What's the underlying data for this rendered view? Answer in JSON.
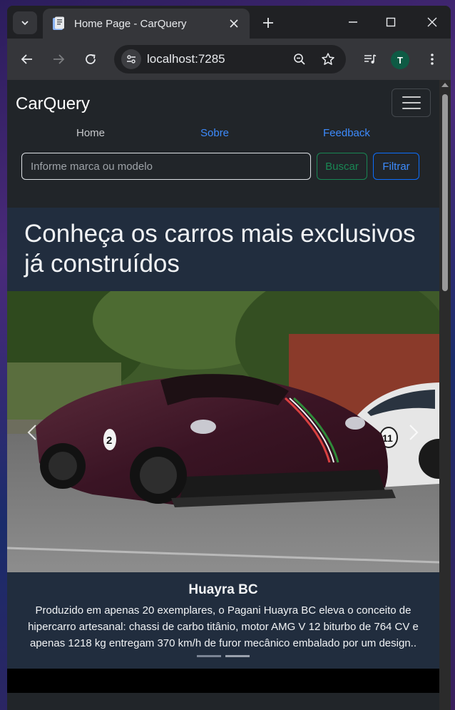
{
  "browser": {
    "tab_title": "Home Page - CarQuery",
    "url": "localhost:7285",
    "avatar_initial": "T"
  },
  "navbar": {
    "brand": "CarQuery",
    "links": [
      "Home",
      "Sobre",
      "Feedback"
    ],
    "search_placeholder": "Informe marca ou modelo",
    "search_value": "",
    "buscar_label": "Buscar",
    "filtrar_label": "Filtrar"
  },
  "hero": {
    "title": "Conheça os carros mais exclusivos já construídos",
    "slides": [
      {
        "title": "Huayra BC",
        "text": "Produzido em apenas 20 exemplares, o Pagani Huayra BC eleva o conceito de hipercarro artesanal: chassi de carbo titânio, motor AMG V 12 biturbo de 764 CV e apenas 1218 kg entregam 370 km/h de furor mecânico embalado por um design..",
        "car_numbers": [
          "2",
          "11"
        ]
      }
    ],
    "indicator_count": 2,
    "active_indicator": 1
  },
  "colors": {
    "navbar_bg": "#212529",
    "hero_bg": "#212d3e",
    "link_blue": "#3d8bfd",
    "link_muted": "#c7c9cc",
    "success_green": "#198754",
    "primary_blue": "#0d6efd"
  },
  "icons": {
    "tab_search": "chevron-down-icon",
    "favicon": "document-icon",
    "back": "arrow-left-icon",
    "forward": "arrow-right-icon",
    "reload": "reload-icon",
    "site_info": "tune-icon",
    "zoom": "zoom-out-icon",
    "bookmark": "star-icon",
    "media": "media-control-icon",
    "menu": "kebab-menu-icon"
  }
}
